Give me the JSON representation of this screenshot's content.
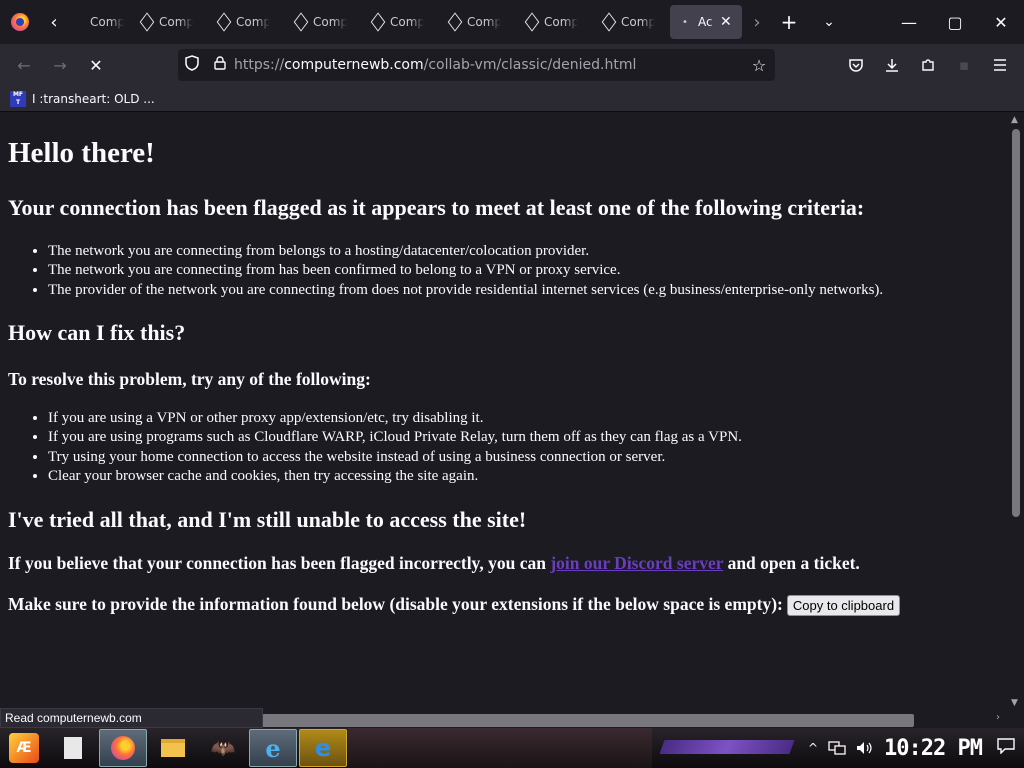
{
  "browser": {
    "tabs": [
      {
        "label": "Comp"
      },
      {
        "label": "Comp"
      },
      {
        "label": "Comp"
      },
      {
        "label": "Comp"
      },
      {
        "label": "Comp"
      },
      {
        "label": "Comp"
      },
      {
        "label": "Comp"
      },
      {
        "label": "Comp"
      }
    ],
    "active_tab": {
      "label": "Ac",
      "dot": "•",
      "close": "✕"
    },
    "scroll_left": "‹",
    "scroll_right": "›",
    "new_tab": "+",
    "all_tabs": "⌄",
    "window": {
      "minimize": "—",
      "maximize": "▢",
      "close": "✕"
    },
    "nav": {
      "back": "←",
      "forward": "→",
      "stop": "✕"
    },
    "url": {
      "scheme": "https://",
      "host": "computernewb.com",
      "path": "/collab-vm/classic/denied.html"
    },
    "bookmark": {
      "icon_text": "MF T",
      "label": "I :transheart: OLD ..."
    },
    "status_text": "Read computernewb.com"
  },
  "page": {
    "heading": "Hello there!",
    "flagged_heading": "Your connection has been flagged as it appears to meet at least one of the following criteria:",
    "criteria": [
      "The network you are connecting from belongs to a hosting/datacenter/colocation provider.",
      "The network you are connecting from has been confirmed to belong to a VPN or proxy service.",
      "The provider of the network you are connecting from does not provide residential internet services (e.g business/enterprise-only networks)."
    ],
    "fix_heading": "How can I fix this?",
    "resolve_heading": "To resolve this problem, try any of the following:",
    "fixes": [
      "If you are using a VPN or other proxy app/extension/etc, try disabling it.",
      "If you are using programs such as Cloudflare WARP, iCloud Private Relay, turn them off as they can flag as a VPN.",
      "Try using your home connection to access the website instead of using a business connection or server.",
      "Clear your browser cache and cookies, then try accessing the site again."
    ],
    "still_heading": "I've tried all that, and I'm still unable to access the site!",
    "incorrect_before": "If you believe that your connection has been flagged incorrectly, you can ",
    "discord_link": "join our Discord server",
    "incorrect_after": " and open a ticket.",
    "provide_info": "Make sure to provide the information found below (disable your extensions if the below space is empty):",
    "copy_button": "Copy to clipboard"
  },
  "taskbar": {
    "start_label": "Æ",
    "clock": "10:22 PM",
    "show_hidden": "^"
  },
  "colors": {
    "page_bg": "#1c1b22",
    "toolbar_bg": "#2b2a33",
    "link": "#6a3dbf"
  }
}
